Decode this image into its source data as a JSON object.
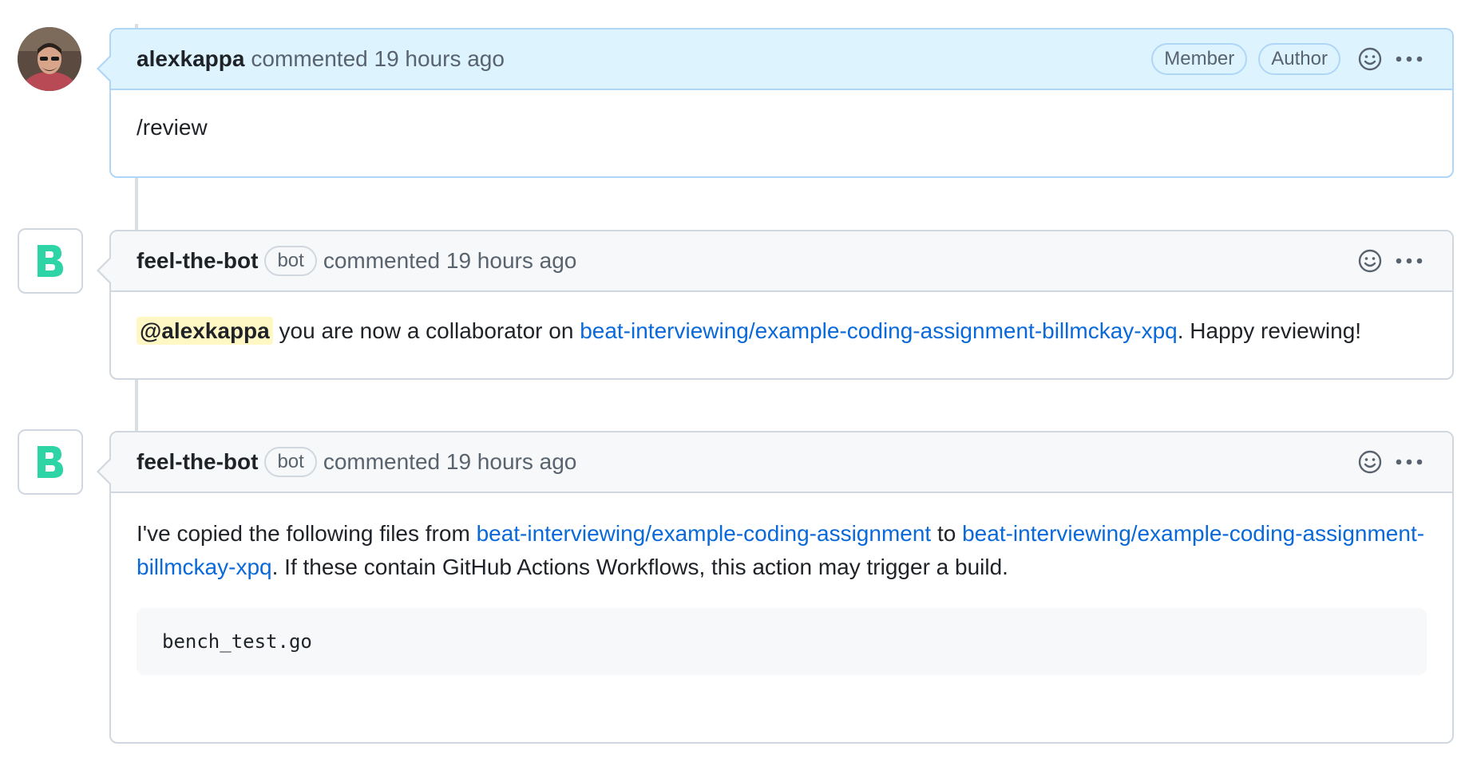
{
  "comments": [
    {
      "author": "alexkappa",
      "meta": "commented 19 hours ago",
      "badges": [
        "Member",
        "Author"
      ],
      "body": "/review"
    },
    {
      "author": "feel-the-bot",
      "bot_label": "bot",
      "meta": "commented 19 hours ago",
      "body": {
        "mention": "@alexkappa",
        "text1": " you are now a collaborator on ",
        "link": "beat-interviewing/example-coding-assignment-billmckay-xpq",
        "text2": ". Happy reviewing!"
      }
    },
    {
      "author": "feel-the-bot",
      "bot_label": "bot",
      "meta": "commented 19 hours ago",
      "body": {
        "text1": "I've copied the following files from ",
        "link1": "beat-interviewing/example-coding-assignment",
        "text2": " to ",
        "link2": "beat-interviewing/example-coding-assignment-billmckay-xpq",
        "text3": ". If these contain GitHub Actions Workflows, this action may trigger a build.",
        "code": "bench_test.go"
      }
    }
  ],
  "bot_avatar_letter": "B",
  "icons": {
    "reaction": "smiley-icon",
    "more": "kebab-horizontal-icon"
  },
  "colors": {
    "link": "#0969da",
    "bot_avatar": "#2dd4a6",
    "highlight_header": "#ddf4ff",
    "mention_bg": "#fff8c5"
  }
}
